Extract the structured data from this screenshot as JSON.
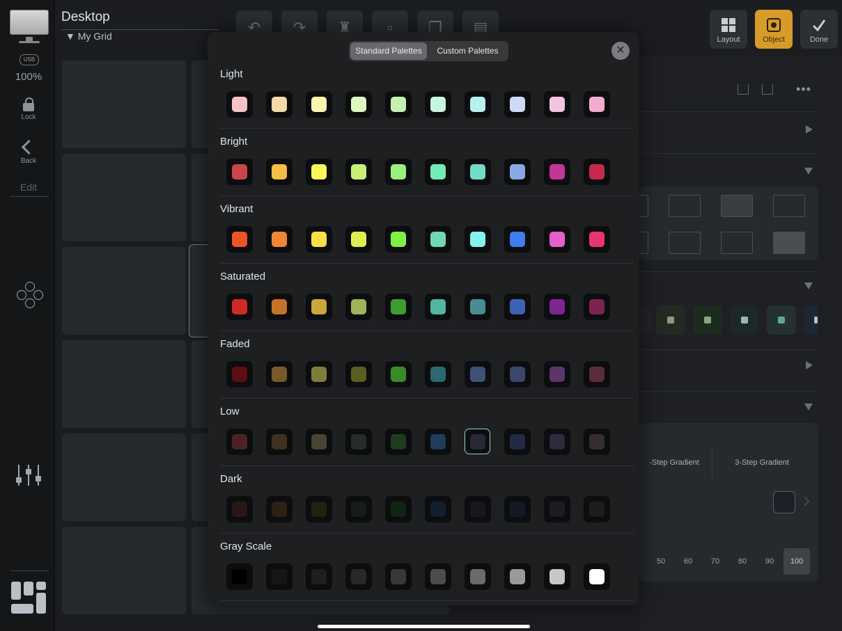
{
  "rail": {
    "usb_badge": "USB",
    "zoom": "100%",
    "lock_label": "Lock",
    "back_label": "Back",
    "edit_label": "Edit"
  },
  "header": {
    "title": "Desktop",
    "grid_name": "My Grid",
    "layout_label": "Layout",
    "object_label": "Object",
    "done_label": "Done"
  },
  "right_panel": {
    "gradient_options": [
      "-Step Gradient",
      "3-Step Gradient"
    ],
    "opacity_values": [
      "50",
      "60",
      "70",
      "80",
      "90",
      "100"
    ],
    "opacity_selected": "100"
  },
  "modal": {
    "tabs": [
      "Standard Palettes",
      "Custom Palettes"
    ],
    "active_tab": "Standard Palettes",
    "palettes": [
      {
        "name": "Light",
        "colors": [
          "#f6c2c6",
          "#f5d9a6",
          "#fbf5b0",
          "#def7c0",
          "#c5f0b0",
          "#c6f5e0",
          "#b6f1ef",
          "#cfd9f7",
          "#f5c3e3",
          "#f3acd1"
        ]
      },
      {
        "name": "Bright",
        "colors": [
          "#c8464b",
          "#f5be45",
          "#f7f55a",
          "#c5ef75",
          "#9af07c",
          "#72ecb7",
          "#6fdccb",
          "#88a9e6",
          "#c33697",
          "#c8284b"
        ]
      },
      {
        "name": "Vibrant",
        "colors": [
          "#ec5428",
          "#ef8535",
          "#fadf48",
          "#dcef4f",
          "#80f048",
          "#6dd8b2",
          "#84f2ef",
          "#3e7eef",
          "#e260c8",
          "#e93474"
        ]
      },
      {
        "name": "Saturated",
        "colors": [
          "#cc2b26",
          "#c47329",
          "#c9a73b",
          "#9fb45b",
          "#3e9d31",
          "#50b6a0",
          "#4b8c92",
          "#3e62b2",
          "#7c2790",
          "#7b2453"
        ]
      },
      {
        "name": "Faded",
        "colors": [
          "#5b0f0f",
          "#785a2a",
          "#7e7e3a",
          "#5a5f21",
          "#3a8a2c",
          "#2b6870",
          "#3d5276",
          "#3a466d",
          "#5c356a",
          "#5b2c3a"
        ]
      },
      {
        "name": "Low",
        "colors": [
          "#4b2325",
          "#3e3120",
          "#464531",
          "#252c2a",
          "#1d3d1f",
          "#1e3d5a",
          "#272a34",
          "#222a45",
          "#2f2a3e",
          "#372d2f"
        ]
      },
      {
        "name": "Dark",
        "colors": [
          "#2a1617",
          "#2b2013",
          "#202212",
          "#161b1b",
          "#112514",
          "#11202f",
          "#17181c",
          "#131a26",
          "#1f1a25",
          "#201c1d"
        ]
      },
      {
        "name": "Gray Scale",
        "colors": [
          "#000000",
          "#161616",
          "#1f1f1f",
          "#292929",
          "#383838",
          "#4c4c4c",
          "#6a6a6a",
          "#9a9a9a",
          "#c7c7c7",
          "#ffffff"
        ]
      }
    ],
    "selected": {
      "palette": "Low",
      "index": 6
    }
  }
}
